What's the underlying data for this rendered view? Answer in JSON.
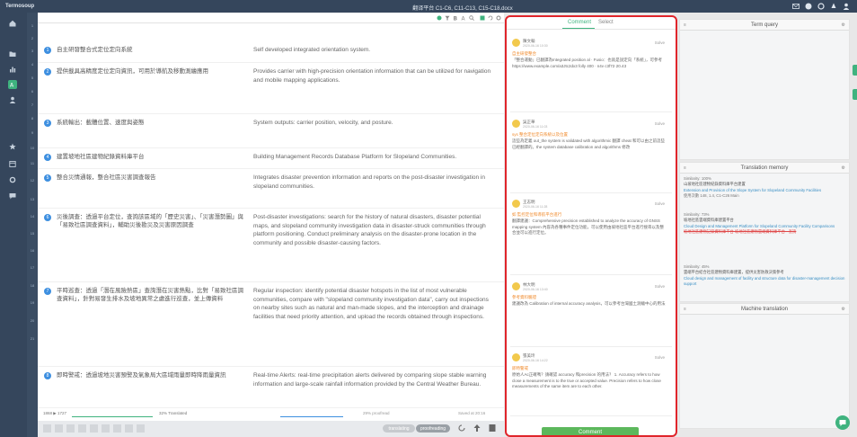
{
  "app": {
    "brand": "Termosoup",
    "document_title": "翻译平台 C1-C6, C11-C13, C15-C18.docx"
  },
  "row_numbers": [
    "1",
    "2",
    "3",
    "4",
    "5",
    "6",
    "7",
    "8",
    "9",
    "10",
    "11",
    "12",
    "13",
    "14",
    "15",
    "16",
    "17",
    "18",
    "19",
    "20",
    "21"
  ],
  "segments": [
    {
      "num": "1",
      "src": "自主研發整合式定位定向系統",
      "tgt": "Self developed integrated orientation system."
    },
    {
      "num": "2",
      "src": "提供載具高精度定位定向資訊，可用於導航及移動測繪應用",
      "tgt": "Provides carrier with high-precision orientation information that can be utilized for navigation and mobile mapping applications."
    },
    {
      "num": "3",
      "src": "系統輸出：載體位置、速度與姿態",
      "tgt": "System outputs: carrier position, velocity, and posture."
    },
    {
      "num": "4",
      "src": "建置坡地社區建物紀錄資料庫平台",
      "tgt": "Building Management Records Database Platform for Slopeland Communities."
    },
    {
      "num": "5",
      "src": "整合災情通報，整合社區災害調查報告",
      "tgt": "Integrates disaster prevention information and reports on the post-disaster investigation in slopeland communities."
    },
    {
      "num": "6",
      "src": "災後調查：透過平台定位，查詢該區域的「歷史災害」、「災害潛勢圖」與「易致社區調查資料」，輔助災後勘災及災害原因調查",
      "tgt": "Post-disaster investigations: search for the history of natural disasters, disaster potential maps, and slopeland community investigation data in disaster-struck communities through platform positioning. Conduct preliminary analysis on the disaster-prone location in the community and possible disaster-causing factors."
    },
    {
      "num": "7",
      "src": "平時巡查：透過「潛在風險熱區」查詢潛在災害熱點，比對「易致社區調查資料」，針對易發生排水及坡地異常之處進行巡查，並上傳資料",
      "tgt": "Regular inspection: identify potential disaster hotspots in the list of most vulnerable communities, compare with \"slopeland community investigation data\", carry out inspections on nearby sites such as natural and man-made slopes, and the interception and drainage facilities that need priority attention, and upload the records obtained through inspections."
    },
    {
      "num": "8",
      "src": "即時警戒：透過坡地災害預警及氣象局大區域雨量即時降雨量資訊",
      "tgt": "Real-time Alerts: real-time precipitation alerts delivered by comparing slope stable warning information and large-scale rainfall information provided by the Central Weather Bureau."
    }
  ],
  "footer": {
    "segments_label": "1868 ▶ 1727",
    "progress1": "32% Translated",
    "progress2": "29% proofread",
    "saved": "Saved at 20:16",
    "mode_translating": "translating",
    "mode_proofreading": "proofreading"
  },
  "comments_panel": {
    "tab_comment": "Comment",
    "tab_select": "Select",
    "action": "Solve",
    "cards": [
      {
        "name": "陳文翰",
        "date": "2020-06-16 10:30",
        "ref": "自主研發整合",
        "text": "「整合運動」已翻譯為Integrated position al · Fusio：也就是說定向「系統」，可參考https://www.example.com/a3Jtc2dx3 folly 400 · n4v c3f72·20.43"
      },
      {
        "name": "吳正華",
        "date": "2020-06-16 11:03",
        "ref": "sys 整合定位定向系統以及位置",
        "text": "這些為定義 out_the system is validated with algorithmic 翻譯 cheat 和可以由之前這些已經翻譯的。the system database calibration and algorithms 修改"
      },
      {
        "name": "王志明",
        "date": "2020-06-16 11:28",
        "ref": "如 監控定位和導航平台進行",
        "text": "翻譯建議：Comprehensive precision established to analyze the accuracy of GNSS mapping system 內容為各種事件定位功能，可以使用由坡地社區平台進行搜尋以及整合並可以進行定位。"
      },
      {
        "name": "林大明",
        "date": "2020-06-16 13:40",
        "ref": "參考資料驗證",
        "text": "建議改為 Calibration of internal accuracy analysis，可以參考台灣國土測繪中心的用法"
      },
      {
        "name": "張美玲",
        "date": "2020-06-16 14:22",
        "ref": "即時警戒",
        "text": "原始人Ac正確嗎？請確認 accuracy 和precision 的用法？ 1. Accuracy refers to how close a measurement is to the true or accepted value. Precision refers to how close measurements of the same item are to each other."
      }
    ],
    "button": "Comment"
  },
  "term_query": {
    "title": "Term query"
  },
  "translation_memory": {
    "title": "Translation memory",
    "entries": [
      {
        "head": "Similarity: 100%",
        "src": "山坡地社區建物紀錄資料庫平台建置",
        "tgt": "Extension and Provision of the Slope System for Slopeland Community Facilities",
        "meta": "使用次數 148, 1.4, C1-C26 Main"
      },
      {
        "head": "Similarity: 73%",
        "src": "坡地社區雲端資料庫建置平台",
        "tgt": "Cloud Design and Management Platform for Slopeland Community Facility Comparisons",
        "meta": "坡地社區建物記錄資料庫平台 坡地社區建物雲端資料庫平台 · 查詢"
      },
      {
        "head": "Similarity: 45%",
        "src": "雲端平台結合社區建物資料庫建置，提供災害防救決策參考",
        "tgt": "Cloud design and management of facility and structure data for disaster-management decision support",
        "meta": ""
      }
    ]
  },
  "machine_translation": {
    "title": "Machine translation"
  },
  "colors": {
    "sidebar": "#35465c",
    "accent": "#3fb37f",
    "highlight": "#e0252b",
    "badge": "#3d8fe0"
  }
}
